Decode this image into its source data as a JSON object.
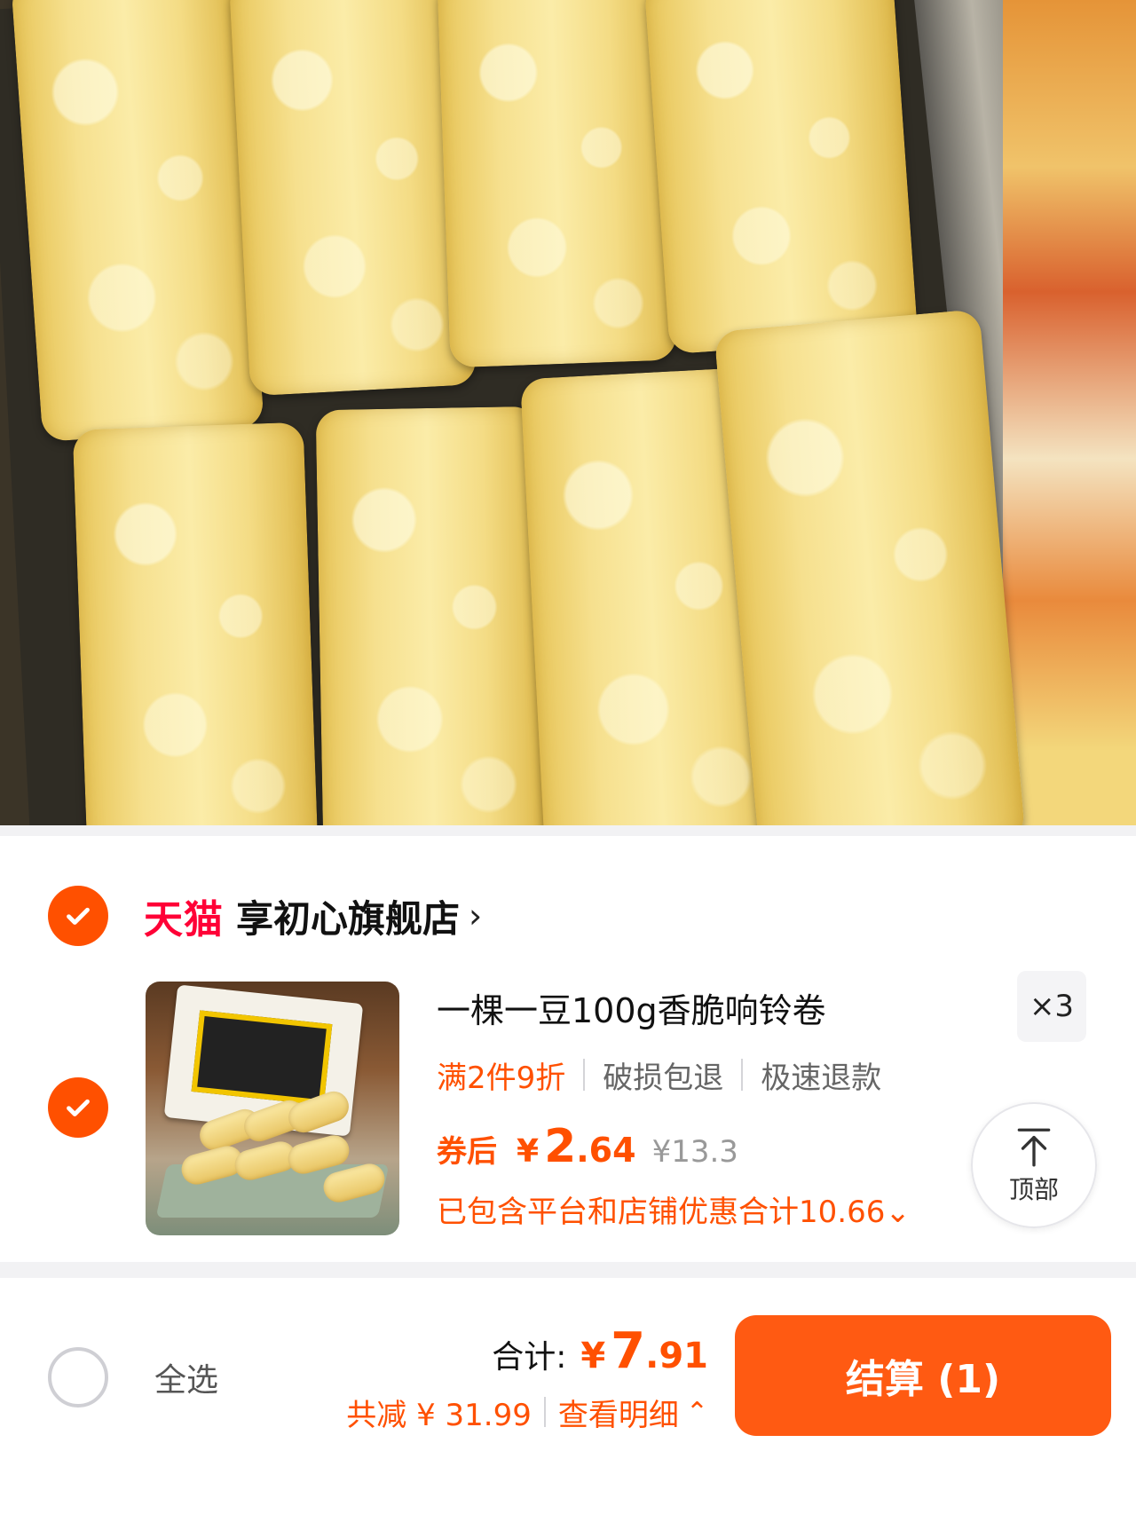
{
  "hero": {
    "image_subject": "fried tofu-skin rolls in a tray"
  },
  "store": {
    "brand": "天猫",
    "name": "享初心旗舰店",
    "chevron_icon": "chevron-right-icon",
    "chevron": "›"
  },
  "item": {
    "title": "一棵一豆100g香脆响铃卷",
    "quantity": "×3",
    "promos": [
      "满2件9折",
      "破损包退",
      "极速退款"
    ],
    "after_coupon_label": "券后",
    "currency": "¥",
    "price_int": "2",
    "price_dec": ".64",
    "original_price": "¥13.3",
    "discount_note": "已包含平台和店铺优惠合计10.66",
    "discount_chevron": "⌄"
  },
  "back_to_top": {
    "label": "顶部",
    "icon": "arrow-up-icon"
  },
  "footer": {
    "select_all": "全选",
    "total_label": "合计:",
    "currency": "¥",
    "total_int": "7",
    "total_dec": ".91",
    "saving": "共减 ¥ 31.99",
    "view_detail": "查看明细",
    "detail_chevron": "⌃",
    "checkout": "结算 (1)"
  },
  "colors": {
    "accent": "#ff5000",
    "tmall_red": "#ff0036",
    "checkout_button": "#ff5a12"
  }
}
